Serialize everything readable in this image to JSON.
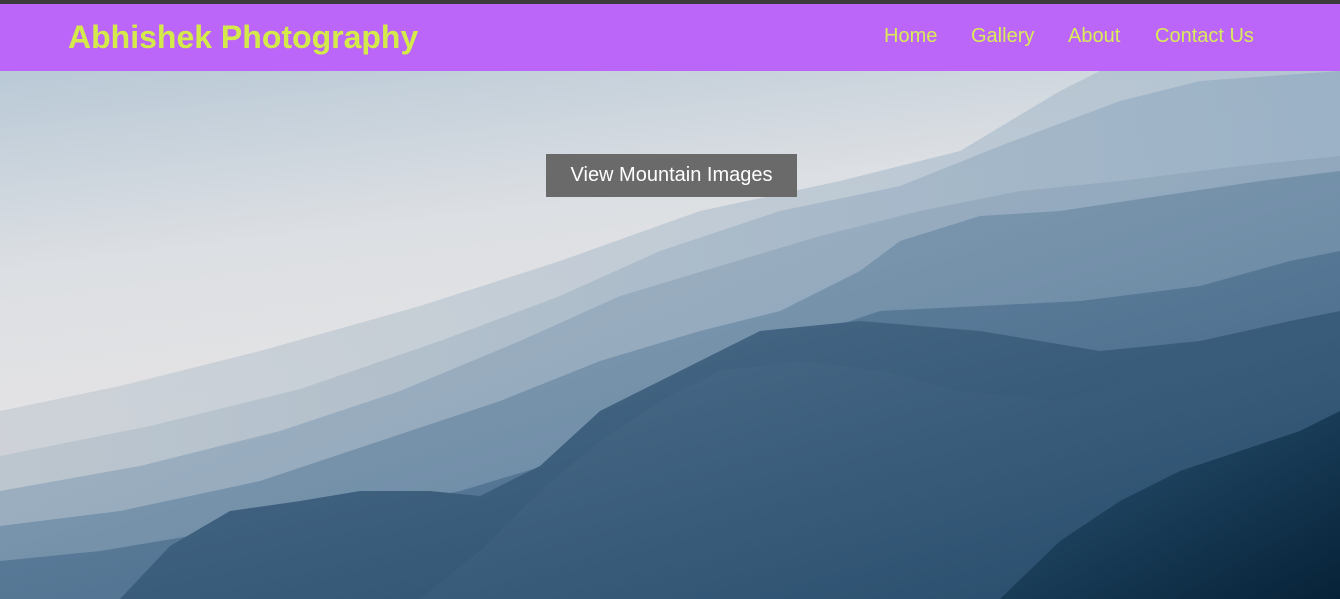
{
  "header": {
    "brand": "Abhishek Photography",
    "brand_color": "#d4ea4b",
    "background_color": "#bb66f8",
    "nav_links": [
      {
        "label": "Home"
      },
      {
        "label": "Gallery"
      },
      {
        "label": "About"
      },
      {
        "label": "Contact Us"
      }
    ],
    "nav_color": "#d9ec58"
  },
  "hero": {
    "image": "misty-mountain-ridges-image",
    "button_label": "View Mountain Images",
    "button_color": "#6a6a6a"
  }
}
